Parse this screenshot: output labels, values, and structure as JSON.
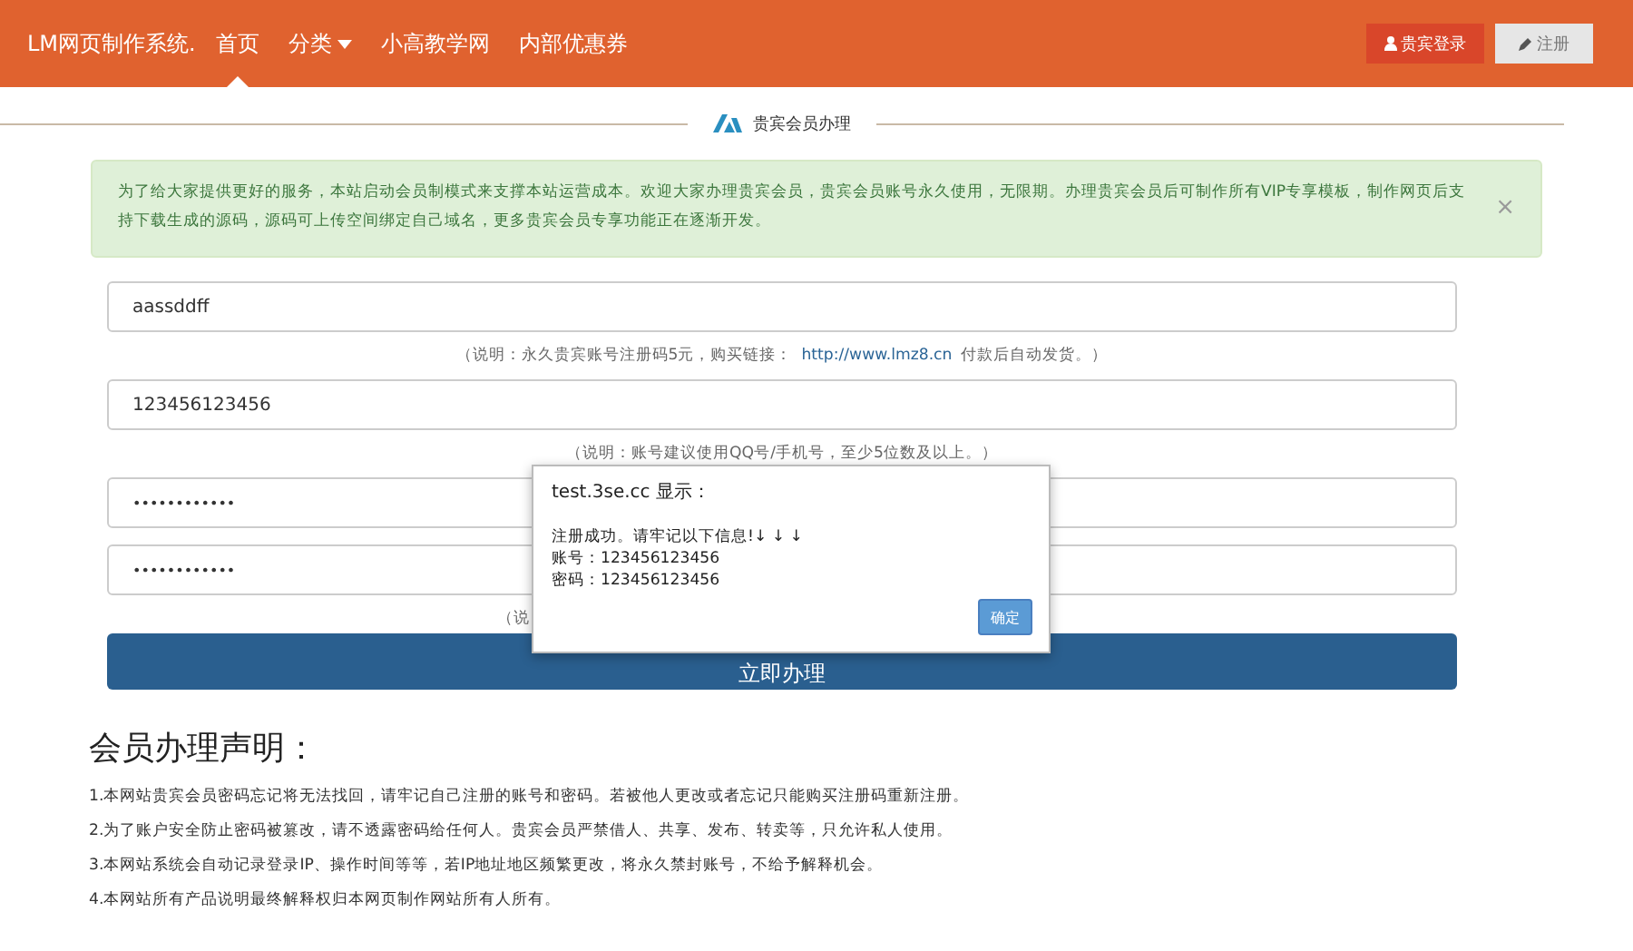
{
  "navbar": {
    "brand": "LM网页制作系统.",
    "links": [
      {
        "label": "首页",
        "selected": true,
        "dropdown": false
      },
      {
        "label": "分类",
        "selected": false,
        "dropdown": true
      },
      {
        "label": "小高教学网",
        "selected": false,
        "dropdown": false
      },
      {
        "label": "内部优惠券",
        "selected": false,
        "dropdown": false
      }
    ],
    "login_button": "贵宾登录",
    "register_button": "注册"
  },
  "section_title": "贵宾会员办理",
  "alert": {
    "text": "为了给大家提供更好的服务，本站启动会员制模式来支撑本站运营成本。欢迎大家办理贵宾会员，贵宾会员账号永久使用，无限期。办理贵宾会员后可制作所有VIP专享模板，制作网页后支持下载生成的源码，源码可上传空间绑定自己域名，更多贵宾会员专享功能正在逐渐开发。",
    "close": "×"
  },
  "fields": [
    {
      "value": "aassddff",
      "kind": "text",
      "hint": "（说明：永久贵宾账号注册码5元，购买链接：",
      "link": "http://www.lmz8.cn",
      "hint_after": "付款后自动发货。）"
    },
    {
      "value": "123456123456",
      "kind": "text",
      "hint": "（说明：账号建议使用QQ号/手机号，至少5位数及以上。）"
    },
    {
      "value": "••••••••••••",
      "kind": "password"
    },
    {
      "value": "••••••••••••",
      "kind": "password",
      "hint": "（说"
    }
  ],
  "submit_button": "立即办理",
  "statement": {
    "title": "会员办理声明：",
    "items": [
      "1.本网站贵宾会员密码忘记将无法找回，请牢记自己注册的账号和密码。若被他人更改或者忘记只能购买注册码重新注册。",
      "2.为了账户安全防止密码被篡改，请不透露密码给任何人。贵宾会员严禁借人、共享、发布、转卖等，只允许私人使用。",
      "3.本网站系统会自动记录登录IP、操作时间等等，若IP地址地区频繁更改，将永久禁封账号，不给予解释机会。",
      "4.本网站所有产品说明最终解释权归本网页制作网站所有人所有。"
    ]
  },
  "dialog": {
    "title": "test.3se.cc 显示：",
    "lines": [
      "注册成功。请牢记以下信息!↓ ↓ ↓",
      "账号：123456123456",
      "密码：123456123456"
    ],
    "ok_button": "确定"
  }
}
